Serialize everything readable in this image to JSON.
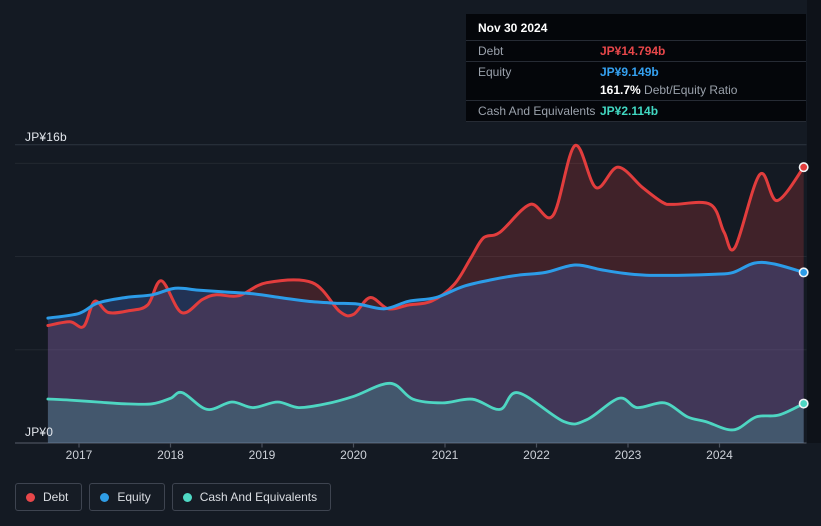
{
  "page": {
    "background": "#141a23"
  },
  "tooltip": {
    "date": "Nov 30 2024",
    "debt_label": "Debt",
    "debt_value": "JP¥14.794b",
    "equity_label": "Equity",
    "equity_value": "JP¥9.149b",
    "ratio_value": "161.7%",
    "ratio_label": "Debt/Equity Ratio",
    "cash_label": "Cash And Equivalents",
    "cash_value": "JP¥2.114b"
  },
  "axis": {
    "y_max_label": "JP¥16b",
    "y_zero_label": "JP¥0"
  },
  "colors": {
    "debt": "#e8474a",
    "equity": "#35a1f0",
    "cash": "#41d8c2",
    "debt_line": "#e23d3d",
    "equity_line": "#2c9ce8",
    "cash_line": "#4ed6c2",
    "gridline": "#222831",
    "gridline_top": "#2d3440",
    "axis_line": "#4a515d"
  },
  "legend": {
    "items": [
      {
        "id": "debt",
        "label": "Debt",
        "color": "#e8474a"
      },
      {
        "id": "equity",
        "label": "Equity",
        "color": "#2f9de6"
      },
      {
        "id": "cash",
        "label": "Cash And Equivalents",
        "color": "#4fd8c4"
      }
    ]
  },
  "chart_data": {
    "type": "area",
    "unit": "JP¥ billions",
    "ylim": [
      0,
      16
    ],
    "y_gridlines": [
      16,
      15,
      10,
      5,
      0
    ],
    "x_ticks": [
      2017,
      2018,
      2019,
      2020,
      2021,
      2022,
      2023,
      2024
    ],
    "x_range": [
      2016.66,
      2024.92
    ],
    "legend_position": "bottom-left",
    "series": [
      {
        "name": "Debt",
        "color": "#e23d3d",
        "fill": "rgba(224,62,62,0.22)",
        "points": [
          [
            2016.66,
            6.3
          ],
          [
            2016.9,
            6.5
          ],
          [
            2017.05,
            6.25
          ],
          [
            2017.17,
            7.6
          ],
          [
            2017.32,
            7.0
          ],
          [
            2017.55,
            7.1
          ],
          [
            2017.75,
            7.4
          ],
          [
            2017.9,
            8.7
          ],
          [
            2018.12,
            7.0
          ],
          [
            2018.35,
            7.7
          ],
          [
            2018.5,
            7.95
          ],
          [
            2018.75,
            7.9
          ],
          [
            2019.05,
            8.6
          ],
          [
            2019.55,
            8.6
          ],
          [
            2019.85,
            7.05
          ],
          [
            2020.0,
            6.9
          ],
          [
            2020.18,
            7.8
          ],
          [
            2020.38,
            7.2
          ],
          [
            2020.6,
            7.4
          ],
          [
            2020.85,
            7.6
          ],
          [
            2021.1,
            8.5
          ],
          [
            2021.28,
            9.9
          ],
          [
            2021.42,
            11.0
          ],
          [
            2021.6,
            11.3
          ],
          [
            2021.93,
            12.8
          ],
          [
            2022.18,
            12.2
          ],
          [
            2022.42,
            15.95
          ],
          [
            2022.65,
            13.7
          ],
          [
            2022.89,
            14.8
          ],
          [
            2023.16,
            13.7
          ],
          [
            2023.38,
            12.9
          ],
          [
            2023.5,
            12.8
          ],
          [
            2023.9,
            12.8
          ],
          [
            2024.05,
            11.3
          ],
          [
            2024.17,
            10.5
          ],
          [
            2024.44,
            14.4
          ],
          [
            2024.63,
            13.0
          ],
          [
            2024.92,
            14.794
          ]
        ]
      },
      {
        "name": "Equity",
        "color": "#2c9ce8",
        "fill": "rgba(70,105,200,0.30)",
        "points": [
          [
            2016.66,
            6.7
          ],
          [
            2017.0,
            6.95
          ],
          [
            2017.2,
            7.5
          ],
          [
            2017.5,
            7.8
          ],
          [
            2017.8,
            7.95
          ],
          [
            2018.05,
            8.3
          ],
          [
            2018.3,
            8.2
          ],
          [
            2018.6,
            8.1
          ],
          [
            2018.9,
            8.0
          ],
          [
            2019.2,
            7.8
          ],
          [
            2019.5,
            7.6
          ],
          [
            2019.8,
            7.5
          ],
          [
            2020.05,
            7.45
          ],
          [
            2020.34,
            7.2
          ],
          [
            2020.6,
            7.6
          ],
          [
            2020.9,
            7.8
          ],
          [
            2021.2,
            8.4
          ],
          [
            2021.5,
            8.75
          ],
          [
            2021.8,
            9.0
          ],
          [
            2022.1,
            9.15
          ],
          [
            2022.42,
            9.55
          ],
          [
            2022.7,
            9.3
          ],
          [
            2022.95,
            9.1
          ],
          [
            2023.2,
            9.0
          ],
          [
            2023.6,
            9.0
          ],
          [
            2023.95,
            9.05
          ],
          [
            2024.15,
            9.15
          ],
          [
            2024.38,
            9.65
          ],
          [
            2024.6,
            9.6
          ],
          [
            2024.92,
            9.149
          ]
        ]
      },
      {
        "name": "Cash And Equivalents",
        "color": "#4ed6c2",
        "fill": "rgba(78,206,188,0.22)",
        "points": [
          [
            2016.66,
            2.36
          ],
          [
            2016.9,
            2.3
          ],
          [
            2017.2,
            2.2
          ],
          [
            2017.5,
            2.1
          ],
          [
            2017.8,
            2.1
          ],
          [
            2018.0,
            2.4
          ],
          [
            2018.13,
            2.7
          ],
          [
            2018.4,
            1.8
          ],
          [
            2018.67,
            2.2
          ],
          [
            2018.9,
            1.9
          ],
          [
            2019.17,
            2.2
          ],
          [
            2019.4,
            1.9
          ],
          [
            2019.7,
            2.1
          ],
          [
            2020.0,
            2.5
          ],
          [
            2020.4,
            3.2
          ],
          [
            2020.65,
            2.35
          ],
          [
            2020.97,
            2.15
          ],
          [
            2021.3,
            2.35
          ],
          [
            2021.6,
            1.8
          ],
          [
            2021.8,
            2.7
          ],
          [
            2022.3,
            1.15
          ],
          [
            2022.55,
            1.25
          ],
          [
            2022.9,
            2.4
          ],
          [
            2023.1,
            1.9
          ],
          [
            2023.4,
            2.15
          ],
          [
            2023.65,
            1.4
          ],
          [
            2023.85,
            1.15
          ],
          [
            2024.15,
            0.7
          ],
          [
            2024.4,
            1.4
          ],
          [
            2024.65,
            1.5
          ],
          [
            2024.92,
            2.114
          ]
        ]
      }
    ],
    "end_markers": [
      {
        "series": "Debt",
        "x": 2024.92,
        "y": 14.794
      },
      {
        "series": "Equity",
        "x": 2024.92,
        "y": 9.149
      },
      {
        "series": "Cash And Equivalents",
        "x": 2024.92,
        "y": 2.114
      }
    ]
  }
}
